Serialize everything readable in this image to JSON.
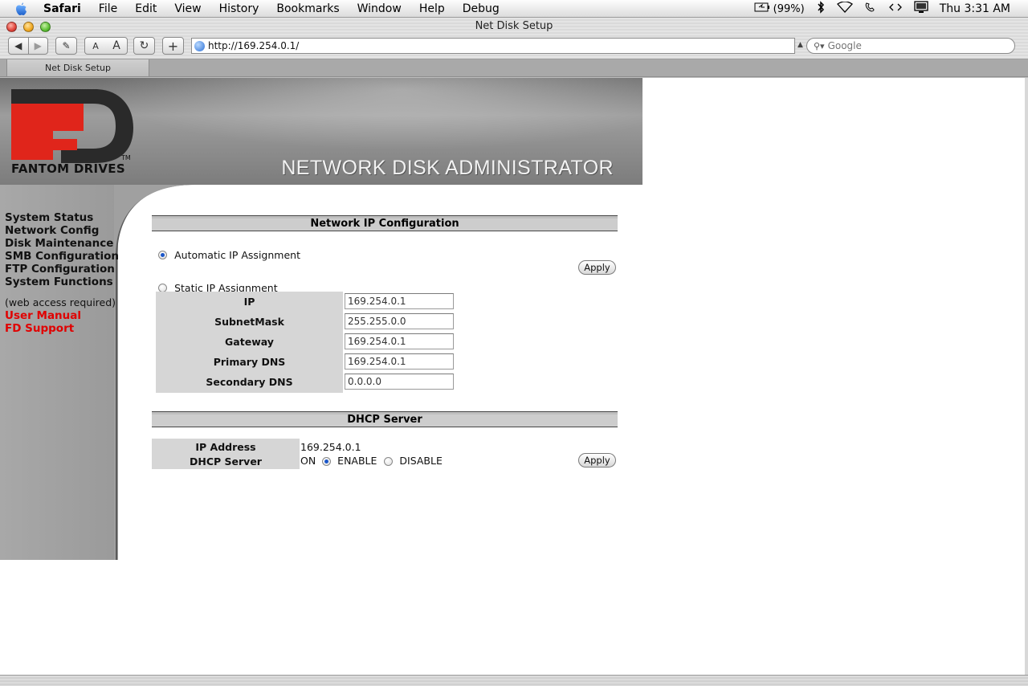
{
  "menubar": {
    "apple_icon": "apple-logo-icon",
    "items": [
      "Safari",
      "File",
      "Edit",
      "View",
      "History",
      "Bookmarks",
      "Window",
      "Help",
      "Debug"
    ],
    "battery": "(99%)",
    "clock": "Thu 3:31 AM"
  },
  "window": {
    "title": "Net Disk Setup",
    "url": "http://169.254.0.1/",
    "search_placeholder": "Google",
    "tab_label": "Net Disk Setup",
    "text_smaller": "A",
    "text_larger": "A",
    "add_label": "+"
  },
  "page": {
    "brand": "FANTOM DRIVES",
    "brand_tm": "TM",
    "title": "NETWORK DISK ADMINISTRATOR",
    "nav": [
      "System Status",
      "Network Config",
      "Disk Maintenance",
      "SMB Configuration",
      "FTP Configuration",
      "System Functions"
    ],
    "nav_note": "(web access required)",
    "nav_links": [
      "User Manual",
      "FD Support"
    ],
    "network": {
      "heading": "Network IP Configuration",
      "auto_label": "Automatic IP Assignment",
      "auto_selected": true,
      "static_label": "Static IP Assignment",
      "apply_label": "Apply",
      "fields": [
        {
          "label": "IP",
          "value": "169.254.0.1"
        },
        {
          "label": "SubnetMask",
          "value": "255.255.0.0"
        },
        {
          "label": "Gateway",
          "value": "169.254.0.1"
        },
        {
          "label": "Primary DNS",
          "value": "169.254.0.1"
        },
        {
          "label": "Secondary DNS",
          "value": "0.0.0.0"
        }
      ]
    },
    "dhcp": {
      "heading": "DHCP Server",
      "ip_label": "IP Address",
      "ip_value": "169.254.0.1",
      "server_label": "DHCP Server",
      "on_label": "ON",
      "enable_label": "ENABLE",
      "disable_label": "DISABLE",
      "enabled": true,
      "apply_label": "Apply"
    }
  },
  "colors": {
    "accent_link": "#e00000",
    "header_gray": "#8c8c8c",
    "sidebar_gray": "#a3a3a3"
  }
}
